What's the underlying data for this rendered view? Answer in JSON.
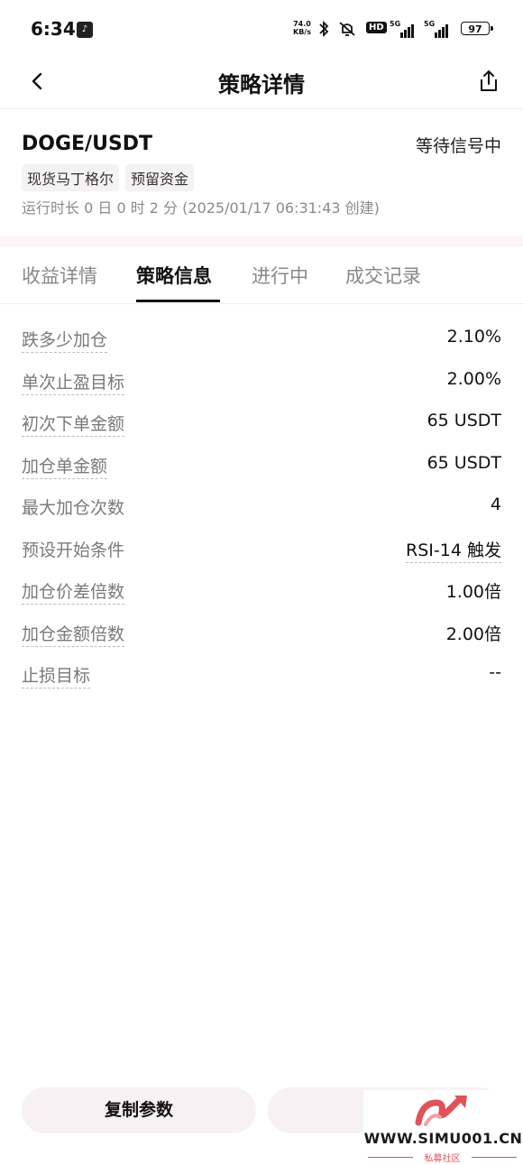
{
  "status_bar": {
    "time": "6:34",
    "net_speed_value": "74.0",
    "net_speed_unit": "KB/s",
    "hd_label": "HD",
    "sig1_label": "5G",
    "sig2_label": "5G",
    "battery": "97"
  },
  "nav": {
    "title": "策略详情",
    "back_icon": "chevron-left-icon",
    "share_icon": "share-icon"
  },
  "header": {
    "pair": "DOGE/USDT",
    "status": "等待信号中",
    "tags": [
      "现货马丁格尔",
      "预留资金"
    ],
    "runtime": "运行时长 0 日 0 时 2 分 (2025/01/17 06:31:43 创建)"
  },
  "tabs": [
    {
      "label": "收益详情",
      "active": false
    },
    {
      "label": "策略信息",
      "active": true
    },
    {
      "label": "进行中",
      "active": false
    },
    {
      "label": "成交记录",
      "active": false
    }
  ],
  "params": [
    {
      "label": "跌多少加仓",
      "value": "2.10%"
    },
    {
      "label": "单次止盈目标",
      "value": "2.00%"
    },
    {
      "label": "初次下单金额",
      "value": "65 USDT"
    },
    {
      "label": "加仓单金额",
      "value": "65 USDT"
    },
    {
      "label": "最大加仓次数",
      "value": "4"
    },
    {
      "label": "预设开始条件",
      "value": "RSI-14 触发"
    },
    {
      "label": "加仓价差倍数",
      "value": "1.00倍"
    },
    {
      "label": "加仓金额倍数",
      "value": "2.00倍"
    },
    {
      "label": "止损目标",
      "value": "--"
    }
  ],
  "buttons": {
    "copy": "复制参数"
  },
  "watermark": {
    "site": "WWW.SIMU001.CN",
    "subtitle": "私募社区"
  },
  "colors": {
    "accent_bg": "#f8f1f4",
    "separator": "#fdf6f9",
    "watermark_red": "#e0525a"
  }
}
